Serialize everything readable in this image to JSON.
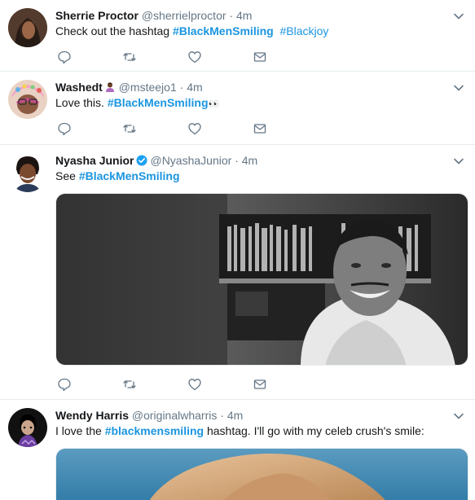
{
  "tweets": [
    {
      "name": "Sherrie Proctor",
      "handle": "@sherrielproctor",
      "dot": "·",
      "time": "4m",
      "text_pre": "Check out the hashtag ",
      "tag1": "#BlackMenSmiling",
      "text_mid": "  ",
      "tag2": "#Blackjoy"
    },
    {
      "name": "Washedt",
      "handle": "@msteejo1",
      "dot": "·",
      "time": "4m",
      "text_pre": "Love this. ",
      "tag1": "#BlackMenSmiling",
      "text_post": "👀"
    },
    {
      "name": "Nyasha Junior",
      "handle": "@NyashaJunior",
      "dot": "·",
      "time": "4m",
      "text_pre": "See ",
      "tag1": "#BlackMenSmiling"
    },
    {
      "name": "Wendy Harris",
      "handle": "@originalwharris",
      "dot": "·",
      "time": "4m",
      "text_pre": "I love the ",
      "tag1": "#blackmensmiling",
      "text_post": " hashtag. I'll go with my celeb crush's smile:"
    }
  ],
  "icons": {
    "reply": "reply-icon",
    "retweet": "retweet-icon",
    "like": "heart-icon",
    "dm": "envelope-icon",
    "more": "chevron-down-icon",
    "verified": "verified-badge-icon"
  },
  "colors": {
    "link": "#1b95e0",
    "muted": "#657786",
    "text": "#14171a",
    "verified": "#1da1f2",
    "border": "#e6ecf0"
  }
}
